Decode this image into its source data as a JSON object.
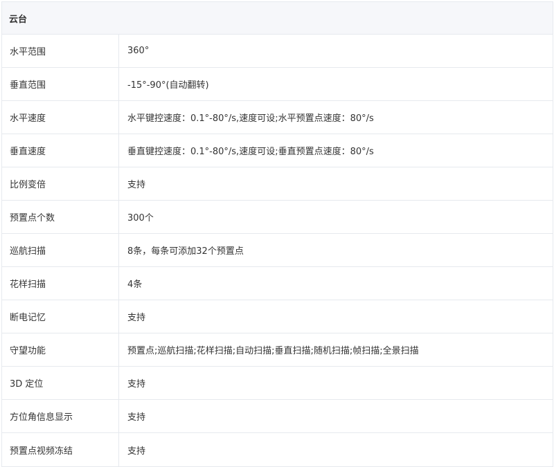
{
  "section": {
    "title": "云台"
  },
  "rows": [
    {
      "label": "水平范围",
      "value": "360°"
    },
    {
      "label": "垂直范围",
      "value": "-15°-90°(自动翻转)"
    },
    {
      "label": "水平速度",
      "value": "水平键控速度：0.1°-80°/s,速度可设;水平预置点速度：80°/s"
    },
    {
      "label": "垂直速度",
      "value": "垂直键控速度：0.1°-80°/s,速度可设;垂直预置点速度：80°/s"
    },
    {
      "label": "比例变倍",
      "value": "支持"
    },
    {
      "label": "预置点个数",
      "value": "300个"
    },
    {
      "label": "巡航扫描",
      "value": "8条，每条可添加32个预置点"
    },
    {
      "label": "花样扫描",
      "value": "4条"
    },
    {
      "label": "断电记忆",
      "value": "支持"
    },
    {
      "label": "守望功能",
      "value": "预置点;巡航扫描;花样扫描;自动扫描;垂直扫描;随机扫描;帧扫描;全景扫描"
    },
    {
      "label": "3D 定位",
      "value": "支持"
    },
    {
      "label": "方位角信息显示",
      "value": "支持"
    },
    {
      "label": "预置点视频冻结",
      "value": "支持"
    }
  ]
}
